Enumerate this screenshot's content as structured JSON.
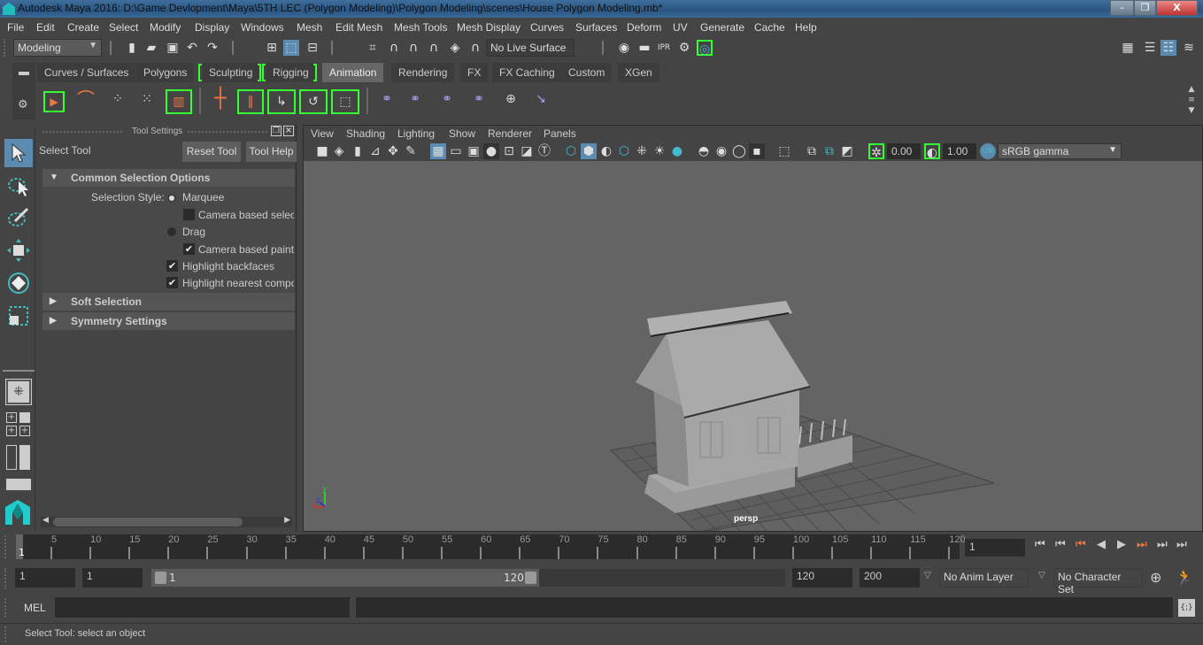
{
  "window": {
    "title": "Autodesk Maya 2016: D:\\Game Devlopment\\Maya\\5TH LEC (Polygon Modeling)\\Polygon Modeling\\scenes\\House Polygon Modeling.mb*",
    "minimize": "–",
    "maximize": "❐",
    "close": "X"
  },
  "menubar": [
    "File",
    "Edit",
    "Create",
    "Select",
    "Modify",
    "Display",
    "Windows",
    "Mesh",
    "Edit Mesh",
    "Mesh Tools",
    "Mesh Display",
    "Curves",
    "Surfaces",
    "Deform",
    "UV",
    "Generate",
    "Cache",
    "Help"
  ],
  "statusline": {
    "menuset": "Modeling",
    "live_surface": "No Live Surface"
  },
  "shelf": {
    "tabs": [
      "Curves / Surfaces",
      "Polygons",
      "Sculpting",
      "Rigging",
      "Animation",
      "Rendering",
      "FX",
      "FX Caching",
      "Custom",
      "XGen"
    ],
    "active_tab": "Animation",
    "icons": [
      "playblast-icon",
      "motion-trail-icon",
      "ghost-icon",
      "unghost-icon",
      "create-clip-icon",
      "set-key-icon",
      "set-breakdown-icon",
      "key-translate-icon",
      "key-rotate-icon",
      "key-scale-icon",
      "parent-constraint-icon",
      "point-constraint-icon",
      "orient-constraint-icon",
      "scale-constraint-icon",
      "aim-constraint-icon",
      "pole-vector-icon"
    ]
  },
  "tool_settings": {
    "panel_title": "Tool Settings",
    "tool_name": "Select Tool",
    "reset_button": "Reset Tool",
    "help_button": "Tool Help",
    "sections": {
      "common": "Common Selection Options",
      "soft": "Soft Selection",
      "symmetry": "Symmetry Settings"
    },
    "selection_style_label": "Selection Style:",
    "marquee": "Marquee",
    "camera_based_selection": "Camera based selecti",
    "drag": "Drag",
    "camera_based_paint": "Camera based paint s",
    "highlight_backfaces": "Highlight backfaces",
    "highlight_nearest": "Highlight nearest compo",
    "state": {
      "style": "Marquee",
      "camera_based_selection": false,
      "camera_based_paint": true,
      "highlight_backfaces": true,
      "highlight_nearest": true
    }
  },
  "viewport": {
    "menus": [
      "View",
      "Shading",
      "Lighting",
      "Show",
      "Renderer",
      "Panels"
    ],
    "exposure": "0.00",
    "gamma": "1.00",
    "color_management": "ON",
    "view_transform": "sRGB gamma",
    "camera_label": "persp",
    "axis": {
      "x": "x",
      "y": "y",
      "z": "z"
    }
  },
  "timeline": {
    "ticks": [
      "5",
      "10",
      "15",
      "20",
      "25",
      "30",
      "35",
      "40",
      "45",
      "50",
      "55",
      "60",
      "65",
      "70",
      "75",
      "80",
      "85",
      "90",
      "95",
      "100",
      "105",
      "110",
      "115",
      "120"
    ],
    "current_frame_marker": "1",
    "current_frame": "1"
  },
  "range": {
    "start": "1",
    "playback_start": "1",
    "slider_start": "1",
    "slider_end": "120",
    "playback_end": "120",
    "end": "200",
    "anim_layer": "No Anim Layer",
    "character_set": "No Character Set"
  },
  "command_line": {
    "language": "MEL",
    "value": ""
  },
  "help_line": "Select Tool: select an object"
}
